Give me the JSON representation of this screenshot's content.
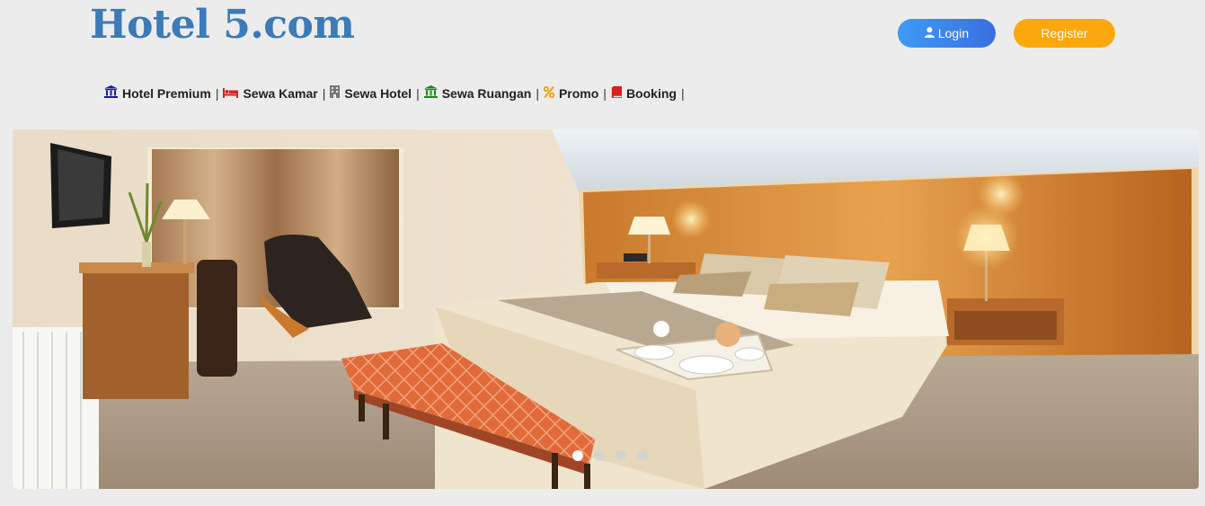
{
  "site": {
    "logo": "Hotel 5.com"
  },
  "header": {
    "login_label": "Login",
    "register_label": "Register"
  },
  "nav": {
    "items": [
      {
        "label": "Hotel Premium",
        "icon": "bank-icon",
        "color": "#1a1aa6"
      },
      {
        "label": "Sewa Kamar",
        "icon": "bed-icon",
        "color": "#d82020"
      },
      {
        "label": "Sewa Hotel",
        "icon": "building-icon",
        "color": "#777777"
      },
      {
        "label": "Sewa Ruangan",
        "icon": "bank-icon",
        "color": "#1a8a1a"
      },
      {
        "label": "Promo",
        "icon": "percent-icon",
        "color": "#f0a010"
      },
      {
        "label": "Booking",
        "icon": "book-icon",
        "color": "#d82020"
      }
    ],
    "separator": "|"
  },
  "carousel": {
    "slides": 4,
    "active_index": 0
  },
  "colors": {
    "logo": "#3c7ab8",
    "login": "#3a7ff0",
    "register": "#fca70e",
    "background": "#ececec"
  }
}
